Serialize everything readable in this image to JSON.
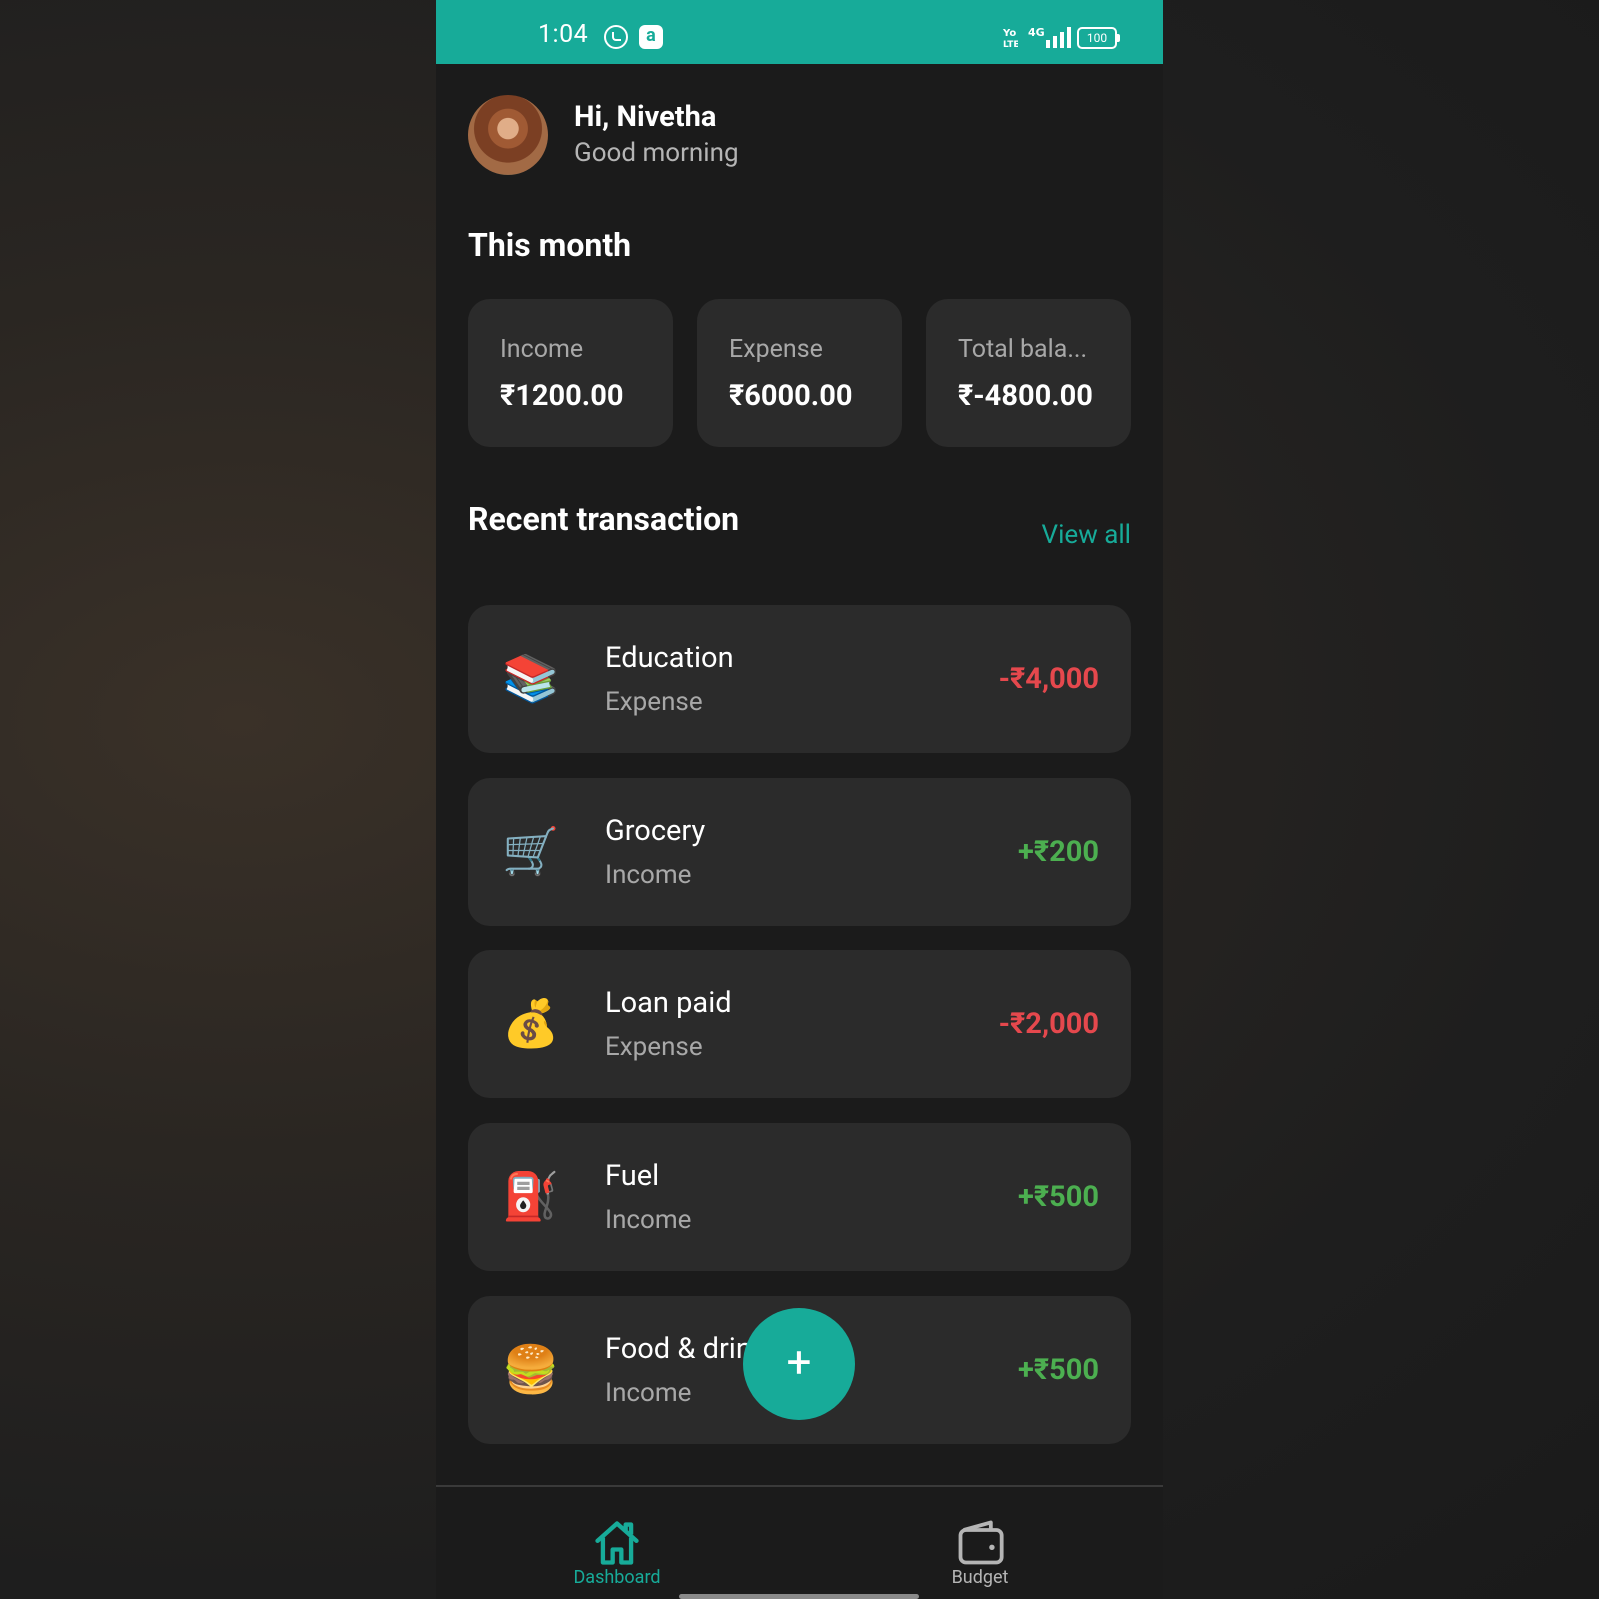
{
  "status_bar": {
    "time": "1:04",
    "battery": "100",
    "network": "4G"
  },
  "header": {
    "greeting": "Hi, Nivetha",
    "subtitle": "Good morning"
  },
  "month": {
    "title": "This month",
    "cards": [
      {
        "label": "Income",
        "value": "₹1200.00"
      },
      {
        "label": "Expense",
        "value": "₹6000.00"
      },
      {
        "label": "Total bala...",
        "value": "₹-4800.00"
      }
    ]
  },
  "recent": {
    "title": "Recent transaction",
    "view_all": "View all",
    "items": [
      {
        "icon": "books-icon",
        "glyph": "📚",
        "name": "Education",
        "type": "Expense",
        "amount": "-₹4,000",
        "sign": "neg"
      },
      {
        "icon": "shopping-cart-icon",
        "glyph": "🛒",
        "name": "Grocery",
        "type": "Income",
        "amount": "+₹200",
        "sign": "pos"
      },
      {
        "icon": "money-bag-icon",
        "glyph": "💰",
        "name": "Loan paid",
        "type": "Expense",
        "amount": "-₹2,000",
        "sign": "neg"
      },
      {
        "icon": "fuel-pump-icon",
        "glyph": "⛽",
        "name": "Fuel",
        "type": "Income",
        "amount": "+₹500",
        "sign": "pos"
      },
      {
        "icon": "burger-icon",
        "glyph": "🍔",
        "name": "Food & drin",
        "type": "Income",
        "amount": "+₹500",
        "sign": "pos"
      }
    ]
  },
  "fab": {
    "label": "+"
  },
  "nav": {
    "items": [
      {
        "label": "Dashboard",
        "active": true,
        "icon": "home-icon"
      },
      {
        "label": "Budget",
        "active": false,
        "icon": "wallet-icon"
      }
    ]
  },
  "colors": {
    "accent": "#17ab99",
    "negative": "#e5484d",
    "positive": "#4caf50",
    "card": "#2b2b2b",
    "background": "#1b1b1b"
  }
}
